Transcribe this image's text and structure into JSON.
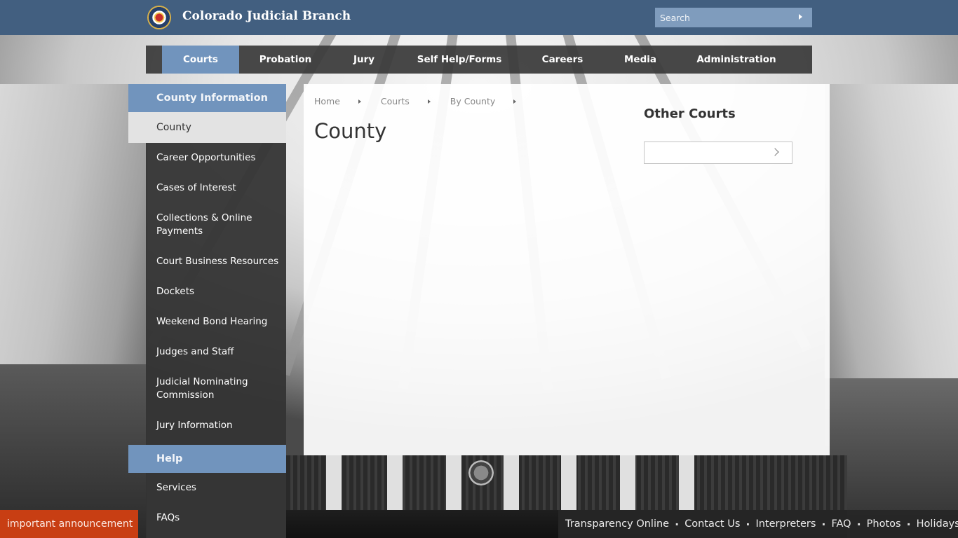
{
  "header": {
    "site_title": "Colorado Judicial Branch",
    "logo_icon": "colorado-courts-seal",
    "search": {
      "placeholder": "Search",
      "value": "",
      "submit_icon": "triangle-right"
    }
  },
  "main_nav": {
    "items": [
      {
        "label": "Courts",
        "active": true
      },
      {
        "label": "Probation",
        "active": false
      },
      {
        "label": "Jury",
        "active": false
      },
      {
        "label": "Self Help/Forms",
        "active": false
      },
      {
        "label": "Careers",
        "active": false
      },
      {
        "label": "Media",
        "active": false
      },
      {
        "label": "Administration",
        "active": false
      }
    ]
  },
  "sidebar": {
    "section_title": "County Information",
    "current_item": "County",
    "items": [
      "Career Opportunities",
      "Cases of Interest",
      "Collections & Online Payments",
      "Court Business Resources",
      "Dockets",
      "Weekend Bond Hearing",
      "Judges and Staff",
      "Judicial Nominating Commission",
      "Jury Information"
    ],
    "help_title": "Help",
    "help_items": [
      "Services",
      "FAQs"
    ]
  },
  "content": {
    "breadcrumb": [
      "Home",
      "Courts",
      "By County"
    ],
    "page_title": "County",
    "other_courts": {
      "title": "Other Courts",
      "select_value": "",
      "select_icon": "chevron-right"
    }
  },
  "footer": {
    "announcement": "important announcement",
    "links": [
      "Transparency Online",
      "Contact Us",
      "Interpreters",
      "FAQ",
      "Photos",
      "Holidays"
    ]
  },
  "colors": {
    "header_bg": "#425f80",
    "accent_blue": "#7194bd",
    "search_bg": "#7f9cbd",
    "nav_bg": "#3a3a3a",
    "announcement_bg": "#c83e13"
  }
}
